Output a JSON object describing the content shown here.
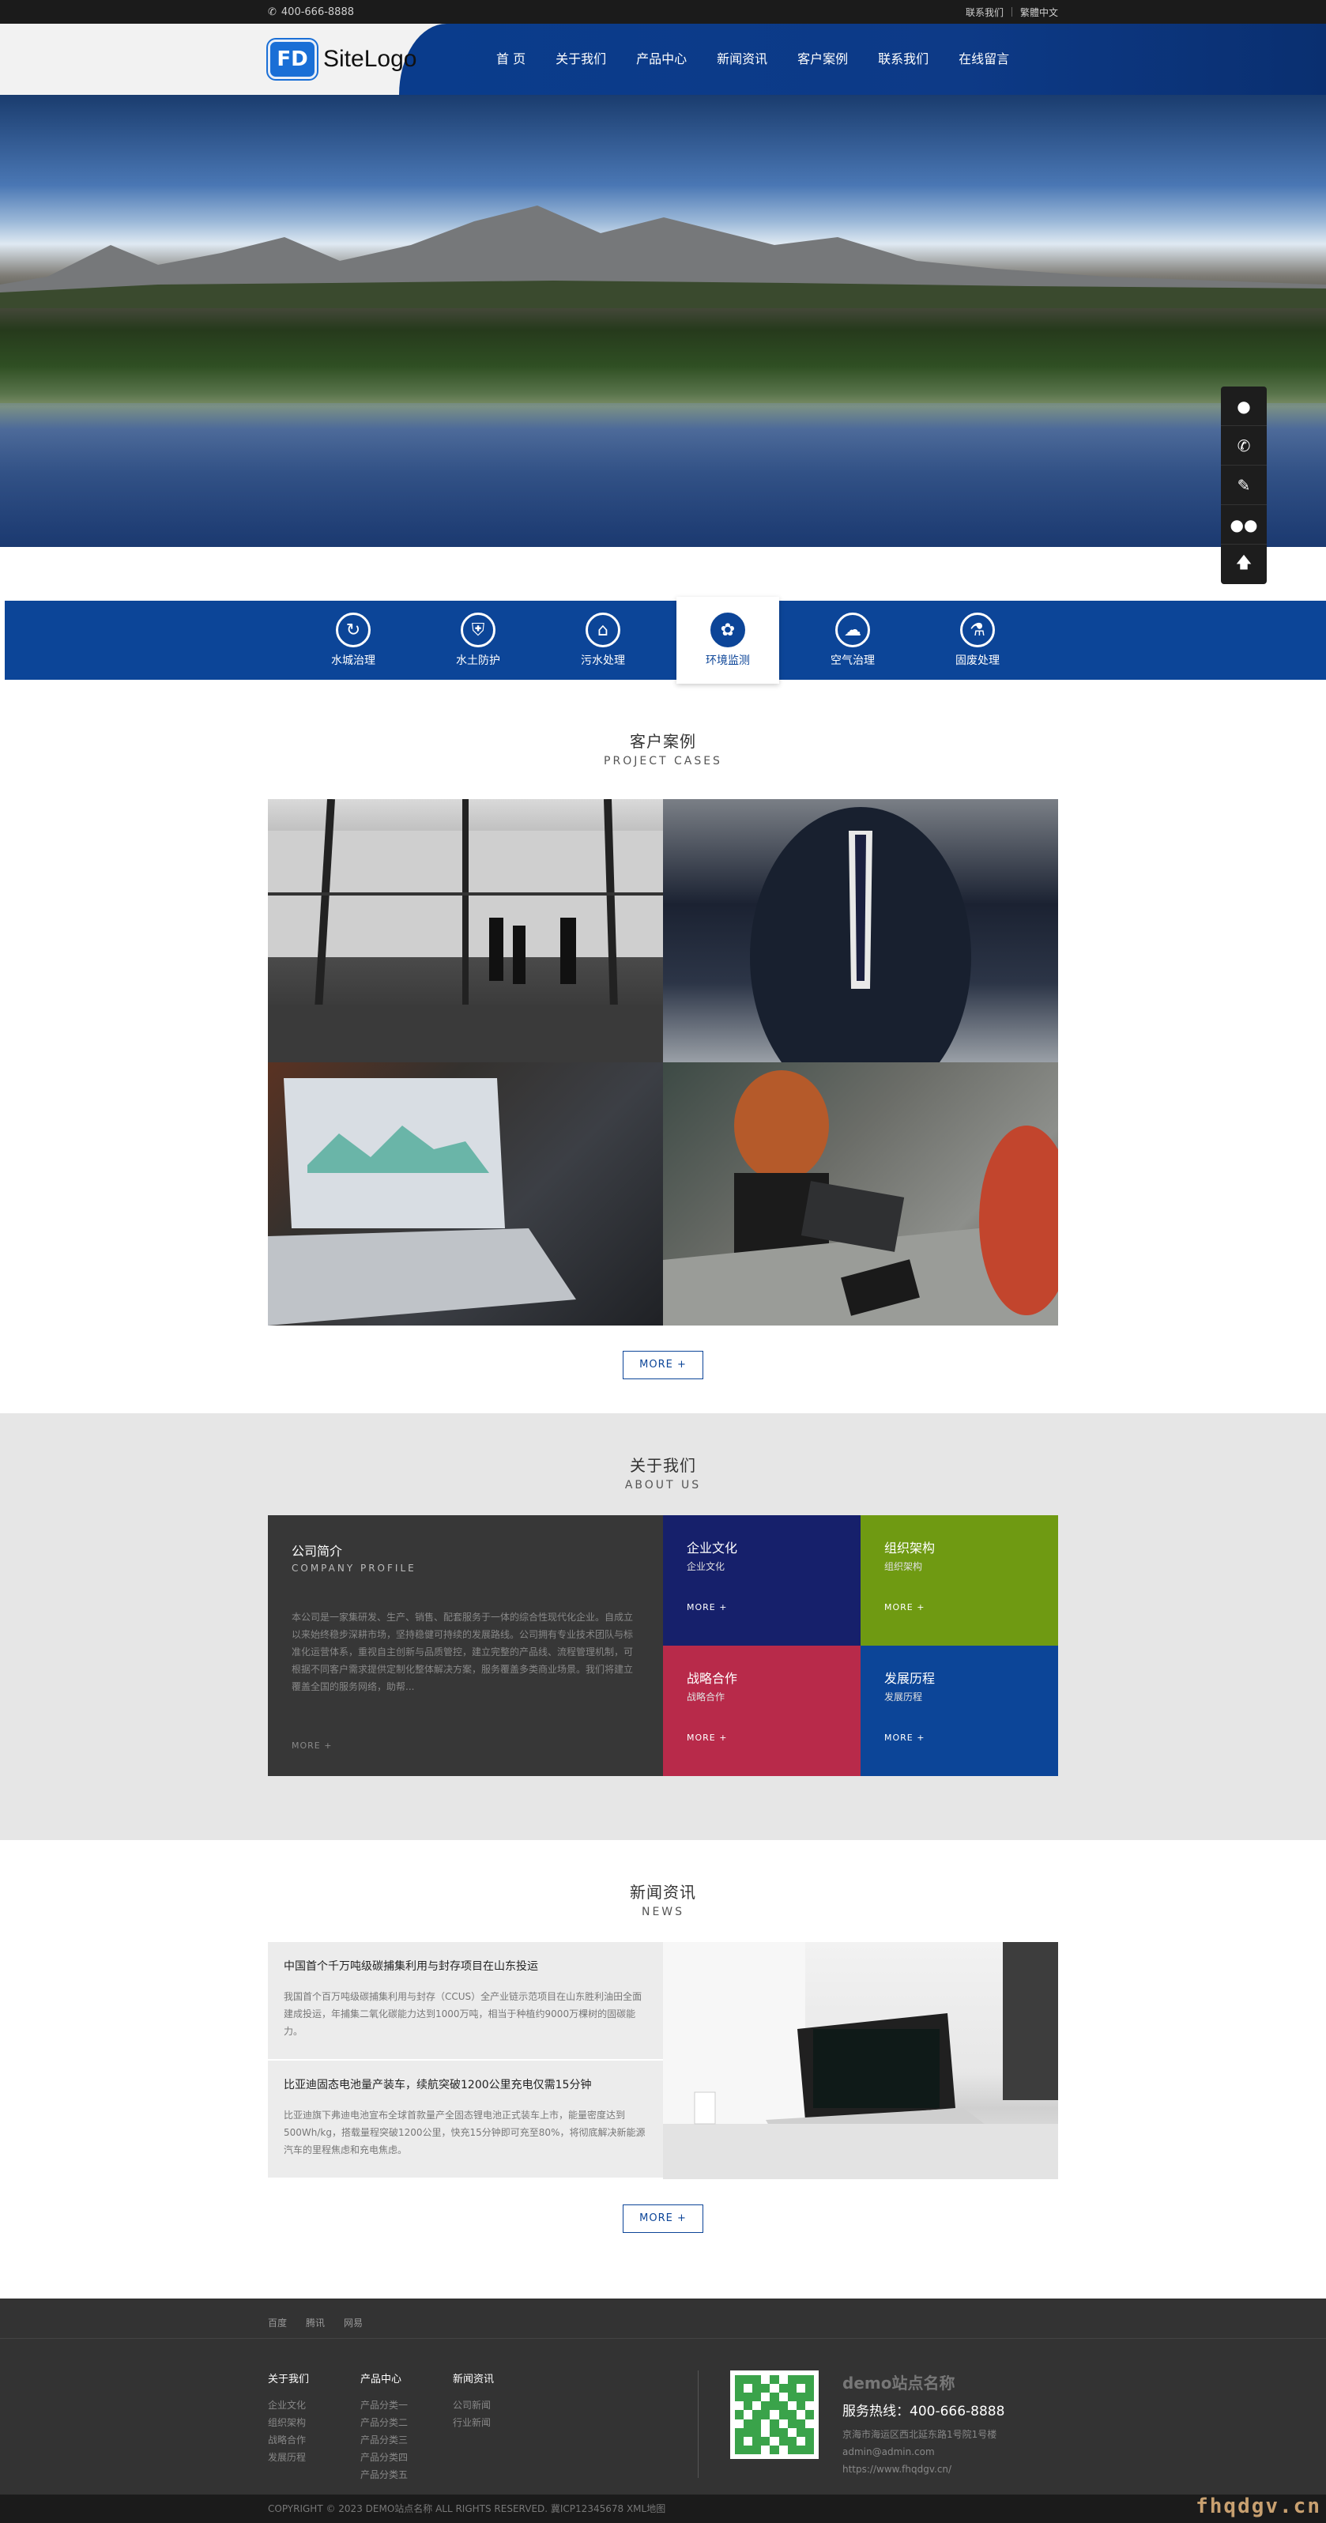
{
  "topbar": {
    "phone": "400-666-8888",
    "contact_link": "联系我们",
    "site_link": "繁體中文"
  },
  "header": {
    "logo_mark": "FD",
    "logo_text": "SiteLogo",
    "nav": [
      "首 页",
      "关于我们",
      "产品中心",
      "新闻资讯",
      "客户案例",
      "联系我们",
      "在线留言"
    ]
  },
  "services": [
    {
      "label": "水城治理",
      "icon": "water-icon"
    },
    {
      "label": "水土防护",
      "icon": "shield-icon"
    },
    {
      "label": "污水处理",
      "icon": "house-water-icon"
    },
    {
      "label": "环境监测",
      "icon": "leaf-icon",
      "active": true
    },
    {
      "label": "空气治理",
      "icon": "pm25-icon"
    },
    {
      "label": "固废处理",
      "icon": "flask-icon"
    }
  ],
  "cases": {
    "title_cn": "客户案例",
    "title_en": "PROJECT CASES",
    "more": "MORE +"
  },
  "about": {
    "title_cn": "关于我们",
    "title_en": "ABOUT US",
    "profile_title": "公司简介",
    "profile_sub": "COMPANY PROFILE",
    "profile_desc": "本公司是一家集研发、生产、销售、配套服务于一体的综合性现代化企业。自成立以来始终稳步深耕市场，坚持稳健可持续的发展路线。公司拥有专业技术团队与标准化运营体系，重视自主创新与品质管控，建立完整的产品线、流程管理机制，可根据不同客户需求提供定制化整体解决方案，服务覆盖多类商业场景。我们将建立覆盖全国的服务网络，助帮...",
    "profile_more": "MORE +",
    "tiles": [
      {
        "title": "企业文化",
        "sub": "企业文化",
        "more": "MORE +",
        "color": "#16206b"
      },
      {
        "title": "组织架构",
        "sub": "组织架构",
        "more": "MORE +",
        "color": "#6f9a12"
      },
      {
        "title": "战略合作",
        "sub": "战略合作",
        "more": "MORE +",
        "color": "#b82a4a"
      },
      {
        "title": "发展历程",
        "sub": "发展历程",
        "more": "MORE +",
        "color": "#0c4598"
      }
    ]
  },
  "news": {
    "title_cn": "新闻资讯",
    "title_en": "NEWS",
    "items": [
      {
        "title": "中国首个千万吨级碳捕集利用与封存项目在山东投运",
        "desc": "我国首个百万吨级碳捕集利用与封存（CCUS）全产业链示范项目在山东胜利油田全面建成投运，年捕集二氧化碳能力达到1000万吨，相当于种植约9000万棵树的固碳能力。"
      },
      {
        "title": "比亚迪固态电池量产装车，续航突破1200公里充电仅需15分钟",
        "desc": "比亚迪旗下弗迪电池宣布全球首款量产全固态锂电池正式装车上市，能量密度达到500Wh/kg，搭载量程突破1200公里，快充15分钟即可充至80%，将彻底解决新能源汽车的里程焦虑和充电焦虑。"
      }
    ],
    "more": "MORE +"
  },
  "footer": {
    "links": [
      "百度",
      "腾讯",
      "网易"
    ],
    "cols": [
      {
        "title": "关于我们",
        "items": [
          "企业文化",
          "组织架构",
          "战略合作",
          "发展历程"
        ]
      },
      {
        "title": "产品中心",
        "items": [
          "产品分类一",
          "产品分类二",
          "产品分类三",
          "产品分类四",
          "产品分类五"
        ]
      },
      {
        "title": "新闻资讯",
        "items": [
          "公司新闻",
          "行业新闻"
        ]
      }
    ],
    "site_name": "demo站点名称",
    "hotline": "服务热线：400-666-8888",
    "address": "京海市海运区西北延东路1号院1号楼",
    "email": "admin@admin.com",
    "url": "https://www.fhqdgv.cn/",
    "copyright": "COPYRIGHT © 2023 DEMO站点名称 ALL RIGHTS RESERVED. 冀ICP12345678 XML地图"
  },
  "watermark": "fhqdgv.cn"
}
